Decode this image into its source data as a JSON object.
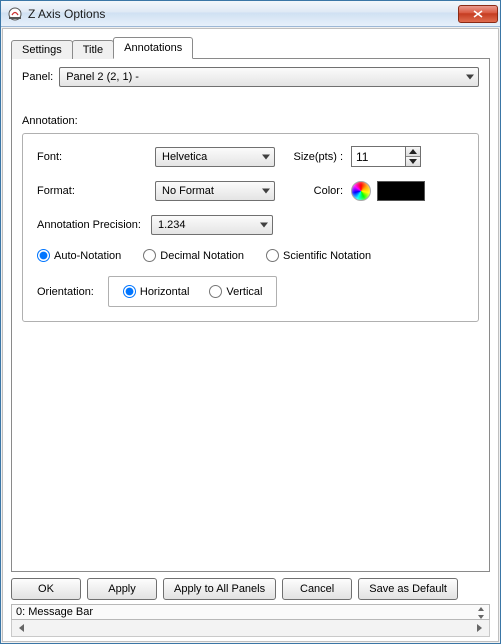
{
  "window": {
    "title": "Z Axis Options"
  },
  "tabs": {
    "settings": "Settings",
    "title_tab": "Title",
    "annotations": "Annotations"
  },
  "panel": {
    "label": "Panel:",
    "value": "Panel 2 (2, 1)  -"
  },
  "annotation": {
    "heading": "Annotation:",
    "font_label": "Font:",
    "font_value": "Helvetica",
    "format_label": "Format:",
    "format_value": "No Format",
    "size_label": "Size(pts) :",
    "size_value": "11",
    "color_label": "Color:",
    "precision_label": "Annotation Precision:",
    "precision_value": "1.234",
    "notations": {
      "auto": "Auto-Notation",
      "decimal": "Decimal Notation",
      "scientific": "Scientific Notation"
    },
    "orientation_label": "Orientation:",
    "orientation": {
      "horizontal": "Horizontal",
      "vertical": "Vertical"
    }
  },
  "buttons": {
    "ok": "OK",
    "apply": "Apply",
    "apply_all": "Apply to All Panels",
    "cancel": "Cancel",
    "save_default": "Save as Default"
  },
  "statusbar": "0: Message Bar"
}
